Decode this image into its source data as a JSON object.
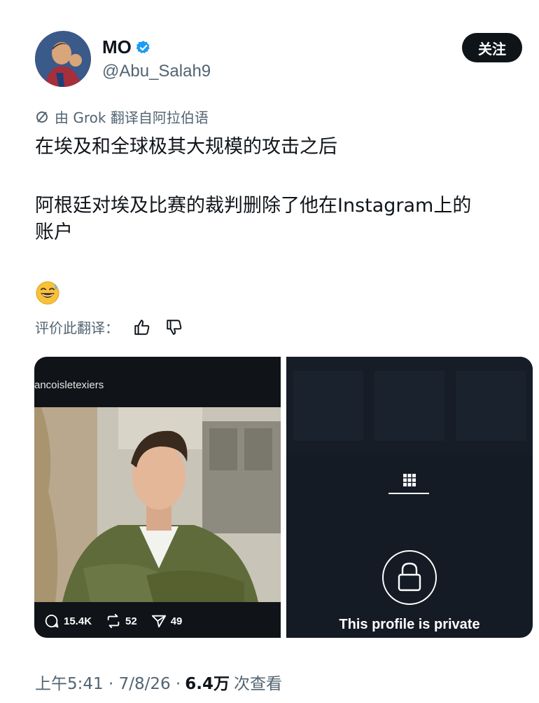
{
  "author": {
    "display_name": "MO",
    "handle": "@Abu_Salah9",
    "verified_icon": "verified-badge-icon"
  },
  "follow_button": {
    "label": "关注"
  },
  "translation": {
    "note": "由 Grok 翻译自阿拉伯语",
    "icon": "translate-icon"
  },
  "tweet": {
    "line1": "在埃及和全球极其大规模的攻击之后",
    "line2": "阿根廷对埃及比赛的裁判删除了他在Instagram上的",
    "line3": "账户",
    "emoji_icon": "grinning-sweat-emoji-icon"
  },
  "rate": {
    "label": "评价此翻译：",
    "like_icon": "thumbs-up-icon",
    "dislike_icon": "thumbs-down-icon"
  },
  "media": {
    "left": {
      "username": "ancoisletexiers",
      "stats": {
        "comments": "15.4K",
        "reposts": "52",
        "shares": "49"
      }
    },
    "right": {
      "private_text": "This profile is private",
      "grid_icon": "grid-icon",
      "lock_icon": "lock-icon"
    }
  },
  "meta": {
    "time": "上午5:41 · 7/8/26 ·",
    "views": "6.4万",
    "views_label": "次查看"
  },
  "colors": {
    "text_primary": "#0f1419",
    "text_secondary": "#536471",
    "verified_blue": "#1d9bf0",
    "follow_bg": "#0f1419"
  }
}
